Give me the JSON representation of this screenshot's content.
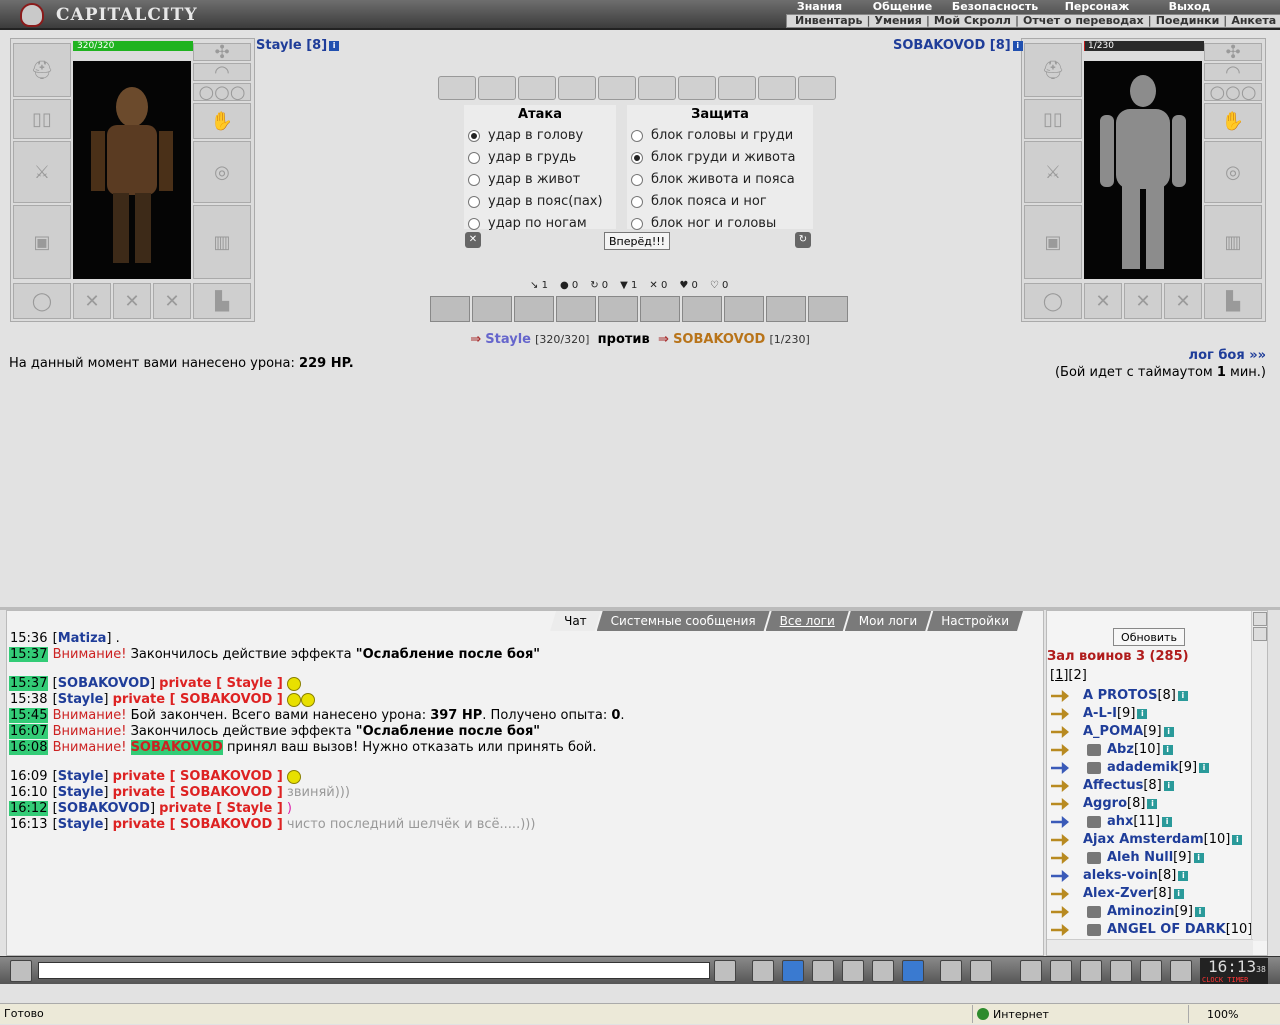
{
  "app": {
    "logo": "CAPITALCITY"
  },
  "menu_top": [
    "Знания",
    "Общение",
    "Безопасность",
    "Персонаж",
    "Выход"
  ],
  "menu_sub": [
    "Инвентарь",
    "Умения",
    "Мой Скролл",
    "Отчет о переводах",
    "Поединки",
    "Анкета"
  ],
  "player": {
    "name": "Stayle [8]",
    "hp_text": "320/320",
    "hp_fraction": 1.0
  },
  "opponent": {
    "name": "SOBAKOVOD [8]",
    "hp_text": "1/230",
    "hp_fraction": 0.004
  },
  "attack": {
    "title": "Атака",
    "options": [
      "удар в голову",
      "удар в грудь",
      "удар в живот",
      "удар в пояс(пах)",
      "удар по ногам"
    ],
    "selected": 0
  },
  "defense": {
    "title": "Защита",
    "options": [
      "блок головы и груди",
      "блок груди и живота",
      "блок живота и пояса",
      "блок пояса и ног",
      "блок ног и головы"
    ],
    "selected": 1
  },
  "go_button": "Вперёд!!!",
  "stats": [
    "1",
    "0",
    "0",
    "1",
    "0",
    "0",
    "0"
  ],
  "versus": {
    "me": "Stayle",
    "me_hp": "[320/320]",
    "word": "против",
    "op": "SOBAKOVOD",
    "op_hp": "[1/230]"
  },
  "damage": {
    "text": "На данный момент вами нанесено урона:",
    "value": "229 HP."
  },
  "battle_log": {
    "link": "лог боя »»",
    "timeout_pre": "(Бой идет с таймаутом",
    "timeout_val": "1",
    "timeout_post": "мин.)"
  },
  "chat": {
    "tabs": [
      "Чат",
      "Системные сообщения",
      "Все логи",
      "Мои логи",
      "Настройки"
    ],
    "messages": [
      {
        "time": "15:36",
        "nick": "Matiza",
        "text": "."
      },
      {
        "time": "15:37",
        "warn": "Внимание!",
        "text": "Закончилось действие эффекта",
        "bold": "\"Ослабление после боя\""
      },
      {
        "time": "15:37",
        "nick": "SOBAKOVOD",
        "priv": "private [ Stayle ]"
      },
      {
        "time": "15:38",
        "nick": "Stayle",
        "priv": "private [ SOBAKOVOD ]"
      },
      {
        "time": "15:45",
        "warn": "Внимание!",
        "text": "Бой закончен. Всего вами нанесено урона:",
        "b1": "397 HP",
        "text2": ". Получено опыта:",
        "b2": "0",
        "text3": "."
      },
      {
        "time": "16:07",
        "warn": "Внимание!",
        "text": "Закончилось действие эффекта",
        "bold": "\"Ослабление после боя\""
      },
      {
        "time": "16:08",
        "warn": "Внимание!",
        "hl": "SOBAKOVOD",
        "text": "принял ваш вызов! Нужно отказать или принять бой."
      },
      {
        "time": "16:09",
        "nick": "Stayle",
        "priv": "private [ SOBAKOVOD ]"
      },
      {
        "time": "16:10",
        "nick": "Stayle",
        "priv": "private [ SOBAKOVOD ]",
        "gtext": "звиняй)))"
      },
      {
        "time": "16:12",
        "nick": "SOBAKOVOD",
        "priv": "private [ Stayle ]",
        "ptext": ")"
      },
      {
        "time": "16:13",
        "nick": "Stayle",
        "priv": "private [ SOBAKOVOD ]",
        "gtext": "чисто последний шелчёк и всё.....)))"
      }
    ]
  },
  "users": {
    "refresh": "Обновить",
    "room": "Зал воинов 3 (285)",
    "pages": [
      "1",
      "2"
    ],
    "list": [
      {
        "name": "A PROTOS",
        "lvl": "[8]"
      },
      {
        "name": "A-L-I",
        "lvl": "[9]"
      },
      {
        "name": "A_POMA",
        "lvl": "[9]"
      },
      {
        "name": "Abz",
        "lvl": "[10]",
        "emb": true
      },
      {
        "name": "adademik",
        "lvl": "[9]",
        "emb": true
      },
      {
        "name": "Affectus",
        "lvl": "[8]"
      },
      {
        "name": "Aggro",
        "lvl": "[8]"
      },
      {
        "name": "ahx",
        "lvl": "[11]",
        "emb": true
      },
      {
        "name": "Ajax Amsterdam",
        "lvl": "[10]"
      },
      {
        "name": "Aleh Null",
        "lvl": "[9]",
        "emb": true
      },
      {
        "name": "aleks-voin",
        "lvl": "[8]"
      },
      {
        "name": "Alex-Zver",
        "lvl": "[8]"
      },
      {
        "name": "Aminozin",
        "lvl": "[9]",
        "emb": true
      },
      {
        "name": "ANGEL OF DARK",
        "lvl": "[10]",
        "emb": true
      }
    ]
  },
  "clock": {
    "time": "16:13",
    "sec": "38",
    "label": "CLOCK TIMER"
  },
  "statusbar": {
    "status": "Готово",
    "zone": "Интернет",
    "zoom": "100%"
  }
}
